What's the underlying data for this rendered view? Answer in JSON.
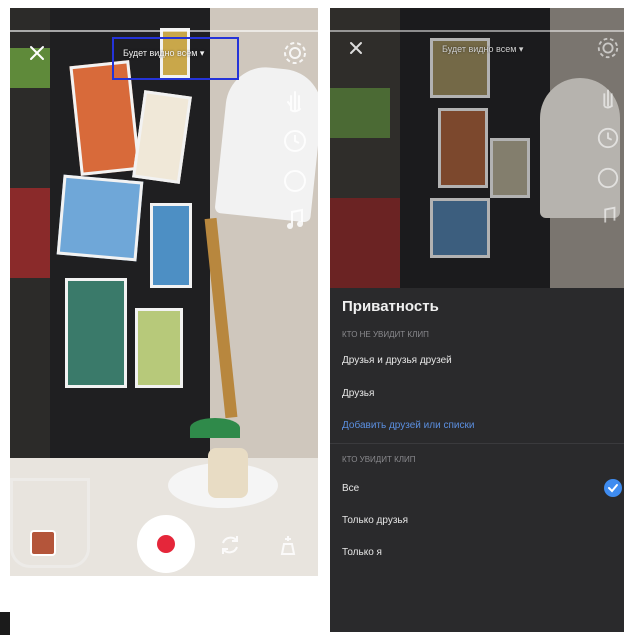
{
  "camera": {
    "audience_label": "Будет видно всем",
    "audience_label_right": "Будет видно всем"
  },
  "privacy": {
    "title": "Приватность",
    "hide_section": "КТО НЕ УВИДИТ КЛИП",
    "hide_options": [
      "Друзья и друзья друзей",
      "Друзья"
    ],
    "add_link": "Добавить друзей или списки",
    "show_section": "КТО УВИДИТ КЛИП",
    "show_options": [
      "Все",
      "Только друзья",
      "Только я"
    ],
    "selected": "Все"
  },
  "colors": {
    "accent": "#3f8cf0",
    "record": "#e5263a",
    "highlight": "#2433d8",
    "sheet_bg": "#2a2a2c"
  },
  "icons": [
    "close-icon",
    "settings-gear-icon",
    "hand-gesture-icon",
    "timer-icon",
    "circle-icon",
    "music-note-icon",
    "record-button",
    "flip-camera-icon",
    "magic-wand-icon",
    "checkmark-icon"
  ]
}
